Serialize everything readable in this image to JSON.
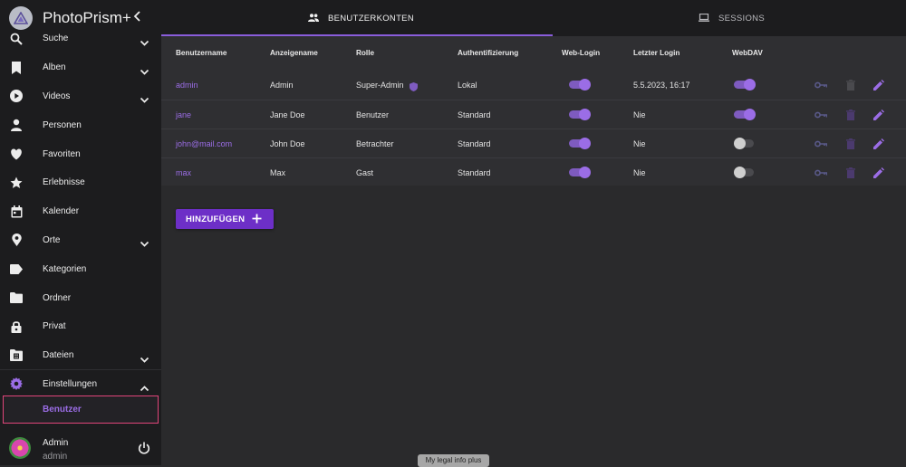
{
  "app": {
    "title": "PhotoPrism+"
  },
  "sidebar": {
    "items": [
      {
        "label": "Suche",
        "icon": "search-icon"
      },
      {
        "label": "Alben",
        "icon": "bookmark-icon"
      },
      {
        "label": "Videos",
        "icon": "play-icon"
      },
      {
        "label": "Personen",
        "icon": "person-icon"
      },
      {
        "label": "Favoriten",
        "icon": "heart-icon"
      },
      {
        "label": "Erlebnisse",
        "icon": "star-icon"
      },
      {
        "label": "Kalender",
        "icon": "calendar-icon"
      },
      {
        "label": "Orte",
        "icon": "location-pin-icon"
      },
      {
        "label": "Kategorien",
        "icon": "label-icon"
      },
      {
        "label": "Ordner",
        "icon": "folder-icon"
      },
      {
        "label": "Privat",
        "icon": "lock-icon"
      },
      {
        "label": "Dateien",
        "icon": "film-folder-icon"
      },
      {
        "label": "Einstellungen",
        "icon": "gear-icon"
      }
    ],
    "sub_item": "Benutzer",
    "user": {
      "name": "Admin",
      "login": "admin"
    }
  },
  "tabs": [
    {
      "label": "BENUTZERKONTEN",
      "icon": "people-icon",
      "active": true
    },
    {
      "label": "SESSIONS",
      "icon": "laptop-icon",
      "active": false
    }
  ],
  "table": {
    "headers": [
      "Benutzername",
      "Anzeigename",
      "Rolle",
      "Authentifizierung",
      "Web-Login",
      "Letzter Login",
      "WebDAV"
    ],
    "rows": [
      {
        "username": "admin",
        "display": "Admin",
        "role": "Super-Admin",
        "auth": "Lokal",
        "web_login": true,
        "last_login": "5.5.2023, 16:17",
        "webdav": true
      },
      {
        "username": "jane",
        "display": "Jane Doe",
        "role": "Benutzer",
        "auth": "Standard",
        "web_login": true,
        "last_login": "Nie",
        "webdav": true
      },
      {
        "username": "john@mail.com",
        "display": "John Doe",
        "role": "Betrachter",
        "auth": "Standard",
        "web_login": true,
        "last_login": "Nie",
        "webdav": false
      },
      {
        "username": "max",
        "display": "Max",
        "role": "Gast",
        "auth": "Standard",
        "web_login": true,
        "last_login": "Nie",
        "webdav": false
      }
    ]
  },
  "add_button": {
    "label": "HINZUFÜGEN"
  },
  "footer": {
    "legal": "My legal info plus"
  },
  "colors": {
    "accent": "#9b6de6",
    "button": "#6d2fc7",
    "highlight_border": "#e0457a"
  }
}
